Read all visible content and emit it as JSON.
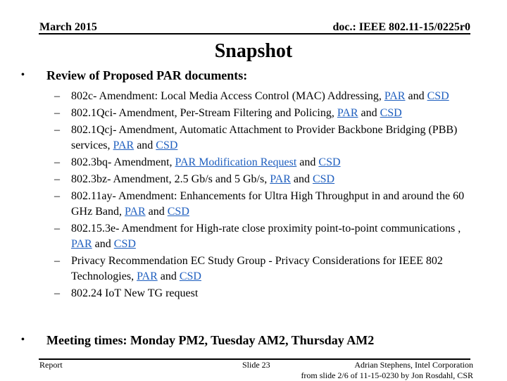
{
  "header": {
    "date": "March 2015",
    "doc_id": "doc.: IEEE 802.11-15/0225r0"
  },
  "title": "Snapshot",
  "bullets": [
    {
      "text": "Review of Proposed PAR documents:"
    },
    {
      "text": "Meeting times: Monday PM2, Tuesday AM2, Thursday AM2"
    }
  ],
  "items": [
    {
      "prefix": "802c- Amendment: Local Media Access Control (MAC) Addressing, ",
      "link1": "PAR",
      "mid": " and ",
      "link2": "CSD"
    },
    {
      "prefix": "802.1Qci- Amendment, Per-Stream Filtering and Policing, ",
      "link1": "PAR",
      "mid": " and ",
      "link2": "CSD"
    },
    {
      "prefix": "802.1Qcj- Amendment, Automatic Attachment to Provider Backbone Bridging (PBB) services, ",
      "link1": "PAR",
      "mid": " and ",
      "link2": "CSD"
    },
    {
      "prefix": "802.3bq- Amendment,  ",
      "link1": "PAR Modification Request",
      "mid": " and ",
      "link2": "CSD"
    },
    {
      "prefix": "802.3bz- Amendment, 2.5 Gb/s and 5 Gb/s, ",
      "link1": "PAR",
      "mid": " and ",
      "link2": "CSD"
    },
    {
      "prefix": "802.11ay- Amendment: Enhancements for Ultra High Throughput in and around the 60 GHz Band, ",
      "link1": "PAR",
      "mid": " and ",
      "link2": "CSD"
    },
    {
      "prefix": "802.15.3e- Amendment for High-rate close proximity point-to-point communications ,  ",
      "link1": "PAR",
      "mid": " and ",
      "link2": "CSD"
    },
    {
      "prefix": "Privacy Recommendation EC Study Group - Privacy Considerations for IEEE 802 Technologies, ",
      "link1": "PAR",
      "mid": " and ",
      "link2": "CSD"
    },
    {
      "prefix": "802.24 IoT New TG request"
    }
  ],
  "dash": "–",
  "bullet_glyph": "•",
  "footer": {
    "left": "Report",
    "center": "Slide 23",
    "right_line1": "Adrian Stephens, Intel Corporation",
    "right_line2": "from slide 2/6 of 11-15-0230 by Jon Rosdahl, CSR"
  },
  "colors": {
    "link": "#1f5fbf"
  }
}
